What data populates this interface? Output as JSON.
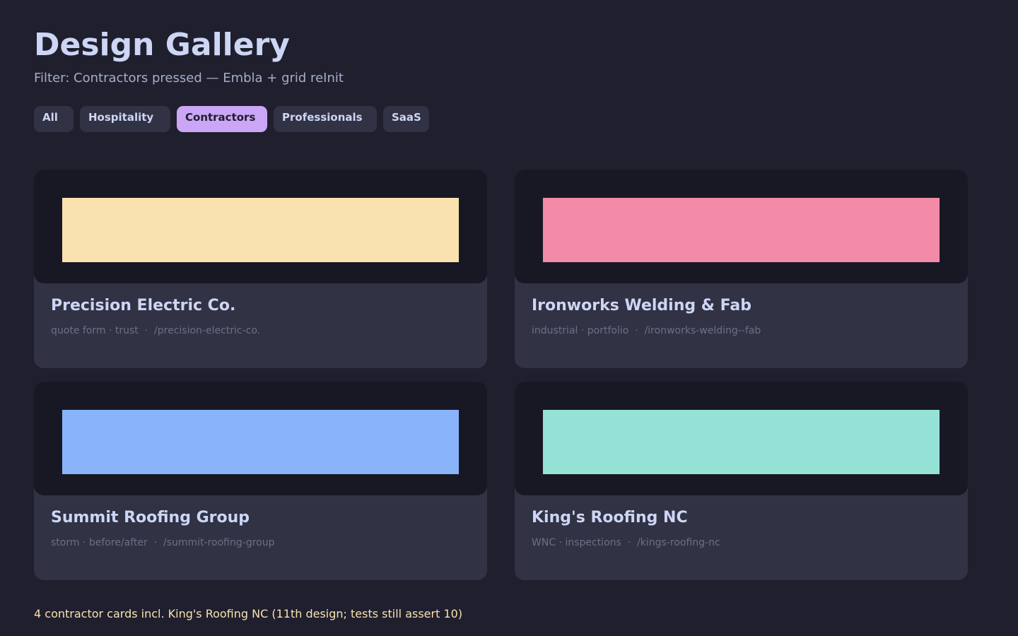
{
  "header": {
    "title": "Design Gallery",
    "subtitle": "Filter: Contractors pressed — Embla + grid reInit"
  },
  "filters": [
    {
      "label": "All",
      "active": false
    },
    {
      "label": "Hospitality",
      "active": false
    },
    {
      "label": "Contractors",
      "active": true
    },
    {
      "label": "Professionals",
      "active": false
    },
    {
      "label": "SaaS",
      "active": false
    }
  ],
  "cards": [
    {
      "title": "Precision Electric Co.",
      "tags": "quote form · trust",
      "slug": "/precision-electric-co.",
      "swatch_color": "#f9e2af"
    },
    {
      "title": "Ironworks Welding & Fab",
      "tags": "industrial · portfolio",
      "slug": "/ironworks-welding--fab",
      "swatch_color": "#f38ba8"
    },
    {
      "title": "Summit Roofing Group",
      "tags": "storm · before/after",
      "slug": "/summit-roofing-group",
      "swatch_color": "#89b4fa"
    },
    {
      "title": "King's Roofing NC",
      "tags": "WNC · inspections",
      "slug": "/kings-roofing-nc",
      "swatch_color": "#94e2d5"
    }
  ],
  "footer": {
    "note": "4 contractor cards incl. King's Roofing NC (11th design; tests still assert 10)"
  },
  "colors": {
    "background": "#1f1f2e",
    "card": "#313244",
    "preview": "#181825",
    "accent": "#cba6f7",
    "note": "#f9e2af"
  }
}
